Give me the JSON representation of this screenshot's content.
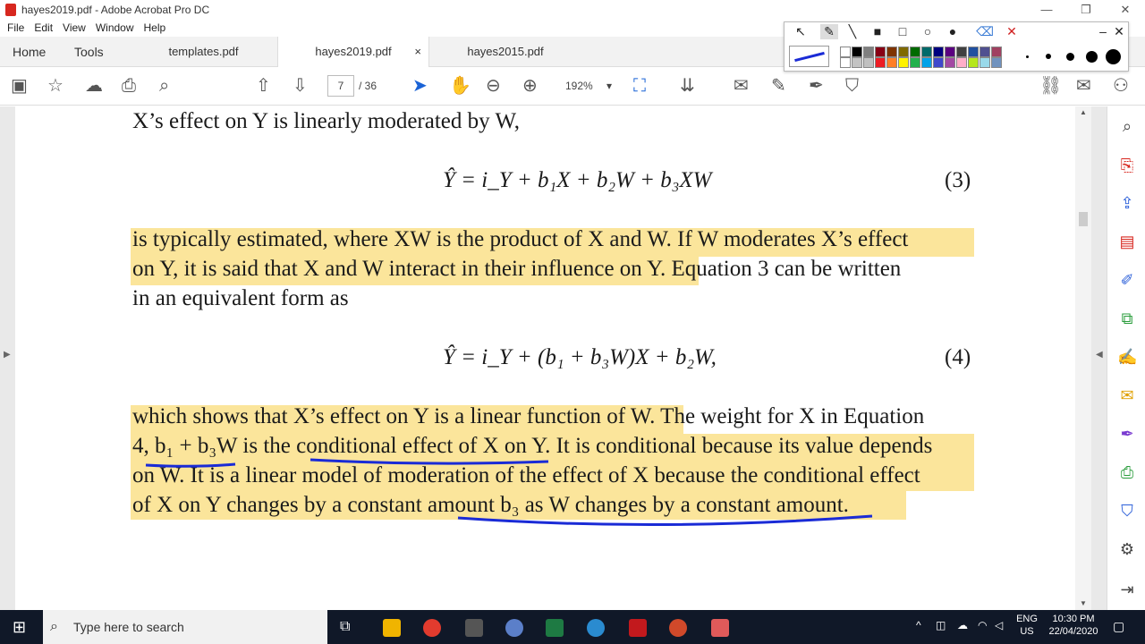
{
  "window": {
    "title": "hayes2019.pdf - Adobe Acrobat Pro DC",
    "minimize": "—",
    "restore": "❐",
    "close": "✕"
  },
  "menu": [
    "File",
    "Edit",
    "View",
    "Window",
    "Help"
  ],
  "tabs": {
    "home": "Home",
    "tools": "Tools",
    "docs": [
      {
        "label": "templates.pdf"
      },
      {
        "label": "hayes2019.pdf",
        "close": "×"
      },
      {
        "label": "hayes2015.pdf"
      }
    ]
  },
  "toolbar": {
    "page_current": "7",
    "page_total": "/ 36",
    "zoom": "192%",
    "zoom_caret": "▾"
  },
  "document": {
    "line1": "X’s effect on Y is linearly moderated by W,",
    "eq3": "Ŷ = i_Y + b₁X + b₂W + b₃XW",
    "eq3_num": "(3)",
    "p1_l1": "is typically estimated, where XW is the product of X and W. If W moderates X’s effect",
    "p1_l2": "on Y, it is said that X and W interact in their influence on Y. Equation 3 can be written",
    "p1_l3": "in an equivalent form as",
    "eq4": "Ŷ = i_Y + (b₁ + b₃W)X + b₂W,",
    "eq4_num": "(4)",
    "p2_l1": "which shows that X’s effect on Y is a linear function of W. The weight for X in Equation",
    "p2_l2": "4, b₁ + b₃W  is the conditional effect of X on Y. It is conditional because its value depends",
    "p2_l3": "on W. It is a linear model of moderation of the effect of X because the conditional effect",
    "p2_l4": "of X on Y changes by a constant amount b₃ as W changes by a constant amount."
  },
  "taskbar": {
    "search_placeholder": "Type here to search",
    "lang": "ENG",
    "region": "US",
    "time": "10:30 PM",
    "date": "22/04/2020"
  },
  "colors": {
    "highlight": "#fbe59b",
    "pen": "#1a2bd6",
    "taskbar": "#101828"
  }
}
